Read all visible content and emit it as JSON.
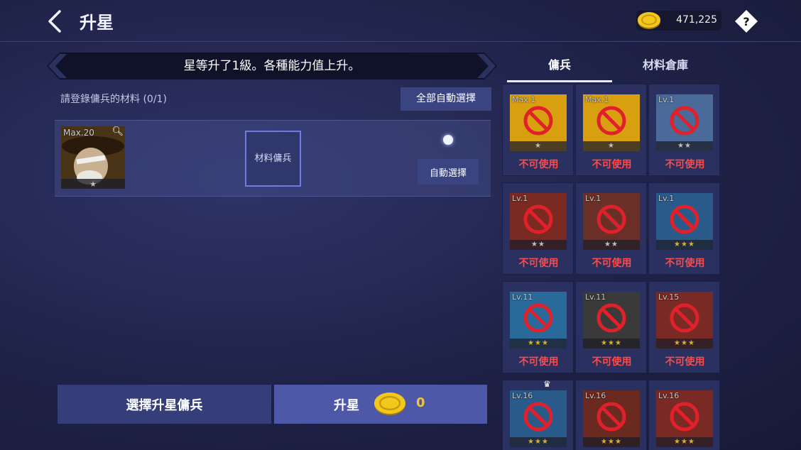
{
  "header": {
    "title": "升星",
    "coins": "471,225",
    "help_symbol": "?"
  },
  "banner": {
    "message": "星等升了1級。各種能力值上升。"
  },
  "register": {
    "label": "請登錄傭兵的材料 (0/1)",
    "auto_all_label": "全部自動選擇",
    "portrait_level": "Max.20",
    "material_slot_label": "材料傭兵",
    "auto_select_label": "自動選擇"
  },
  "footer": {
    "select_label": "選擇升星傭兵",
    "upgrade_label": "升星",
    "upgrade_cost": "0"
  },
  "tabs": {
    "mercenary": "傭兵",
    "storage": "材料倉庫"
  },
  "colors": {
    "accent": "#4e58a8",
    "gold": "#f0c53c",
    "unavailable": "#ff4a4a",
    "ban": "#e0202a"
  },
  "grid": {
    "unavailable_text": "不可使用",
    "items": [
      {
        "level": "Max.1",
        "stars": "★",
        "bg": "#d8a010",
        "star_color": "#bfbfbf"
      },
      {
        "level": "Max.1",
        "stars": "★",
        "bg": "#d8a010",
        "star_color": "#bfbfbf"
      },
      {
        "level": "Lv.1",
        "stars": "★★",
        "bg": "#4a6a9a",
        "star_color": "#bfbfbf"
      },
      {
        "level": "Lv.1",
        "stars": "★★",
        "bg": "#7a2a20",
        "star_color": "#bfbfbf"
      },
      {
        "level": "Lv.1",
        "stars": "★★",
        "bg": "#6a3028",
        "star_color": "#bfbfbf"
      },
      {
        "level": "Lv.1",
        "stars": "★★★",
        "bg": "#2a5a8a",
        "star_color": "#d8b030"
      },
      {
        "level": "Lv.11",
        "stars": "★★★",
        "bg": "#2a6a9a",
        "star_color": "#d8b030"
      },
      {
        "level": "Lv.11",
        "stars": "★★★",
        "bg": "#3a3a3a",
        "star_color": "#d8b030"
      },
      {
        "level": "Lv.15",
        "stars": "★★★",
        "bg": "#7a2a24",
        "star_color": "#d8b030"
      },
      {
        "level": "Lv.16",
        "stars": "★★★",
        "bg": "#2a5a8a",
        "star_color": "#d8b030"
      },
      {
        "level": "Lv.16",
        "stars": "★★★",
        "bg": "#6a2a20",
        "star_color": "#d8b030"
      },
      {
        "level": "Lv.16",
        "stars": "★★★",
        "bg": "#7a2a24",
        "star_color": "#d8b030"
      }
    ]
  }
}
